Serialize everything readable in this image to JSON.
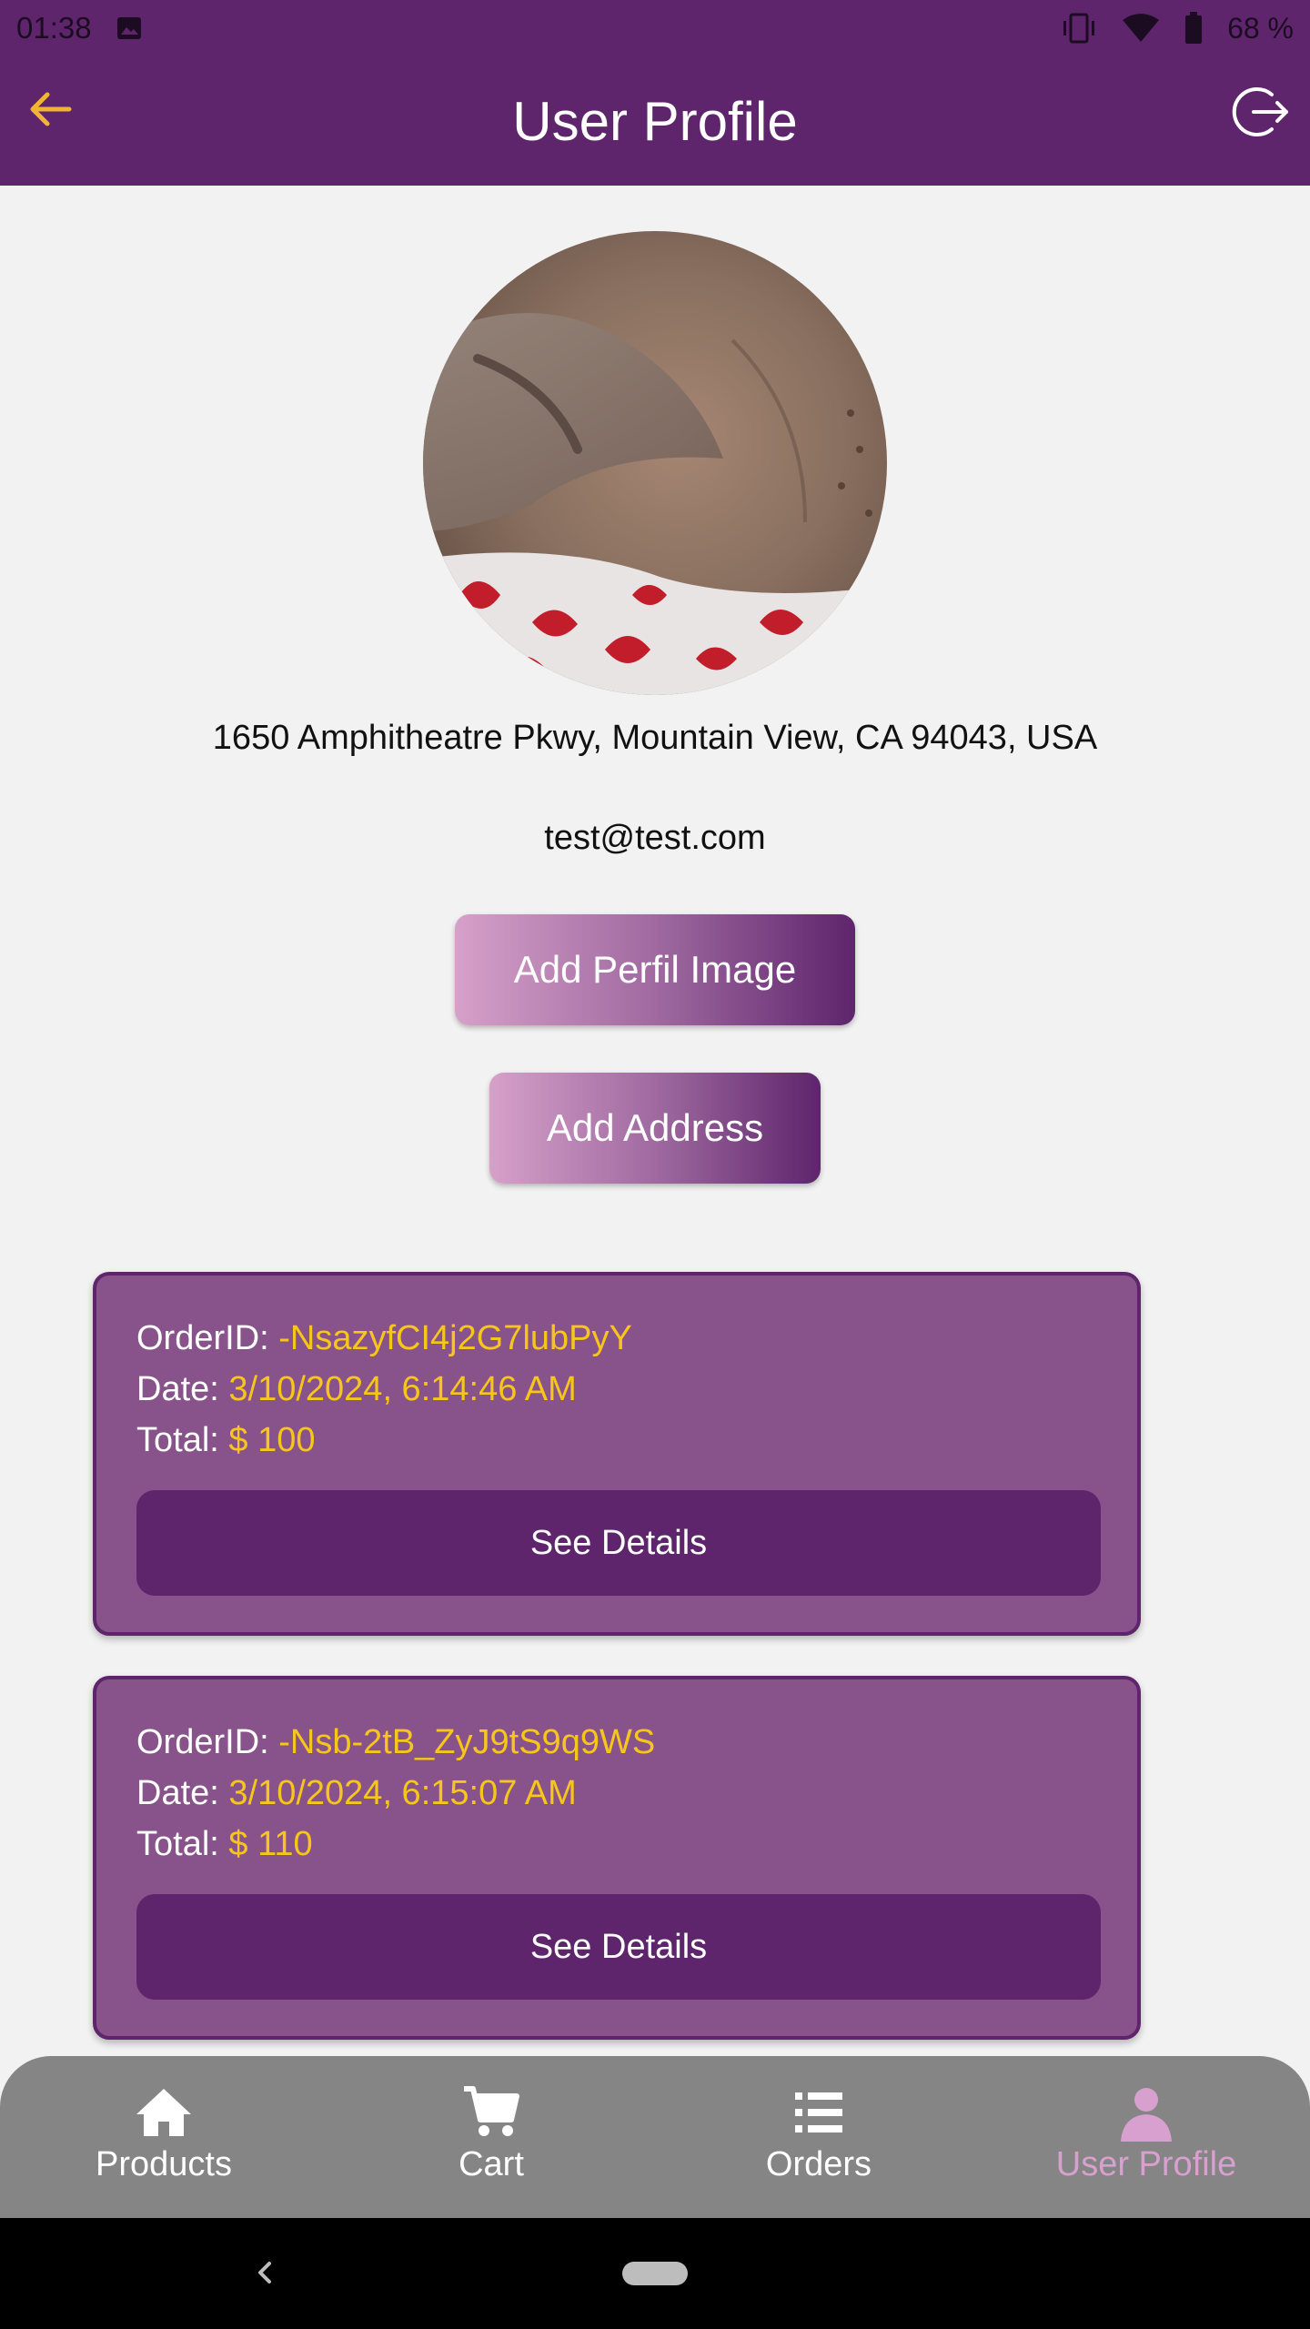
{
  "status_bar": {
    "time": "01:38",
    "battery": "68 %"
  },
  "app_bar": {
    "title": "User Profile"
  },
  "profile": {
    "address": "1650 Amphitheatre Pkwy, Mountain View, CA 94043, USA",
    "email": "test@test.com",
    "add_image_label": "Add Perfil Image",
    "add_address_label": "Add Address"
  },
  "orders": [
    {
      "id_label": "OrderID: ",
      "id": "-NsazyfCI4j2G7lubPyY",
      "date_label": "Date: ",
      "date": "3/10/2024, 6:14:46 AM",
      "total_label": "Total: ",
      "total": "$ 100",
      "button": "See Details"
    },
    {
      "id_label": "OrderID: ",
      "id": "-Nsb-2tB_ZyJ9tS9q9WS",
      "date_label": "Date: ",
      "date": "3/10/2024, 6:15:07 AM",
      "total_label": "Total: ",
      "total": "$ 110",
      "button": "See Details"
    }
  ],
  "bottom_nav": {
    "items": [
      {
        "label": "Products",
        "icon": "home-icon"
      },
      {
        "label": "Cart",
        "icon": "cart-icon"
      },
      {
        "label": "Orders",
        "icon": "list-icon"
      },
      {
        "label": "User Profile",
        "icon": "person-icon",
        "active": true
      }
    ]
  },
  "colors": {
    "primary": "#5e256c",
    "card": "#88528a",
    "accent_value": "#f7c61b",
    "back_arrow": "#f1b434",
    "nav_active": "#d8a0cf",
    "nav_bg": "#858585"
  }
}
